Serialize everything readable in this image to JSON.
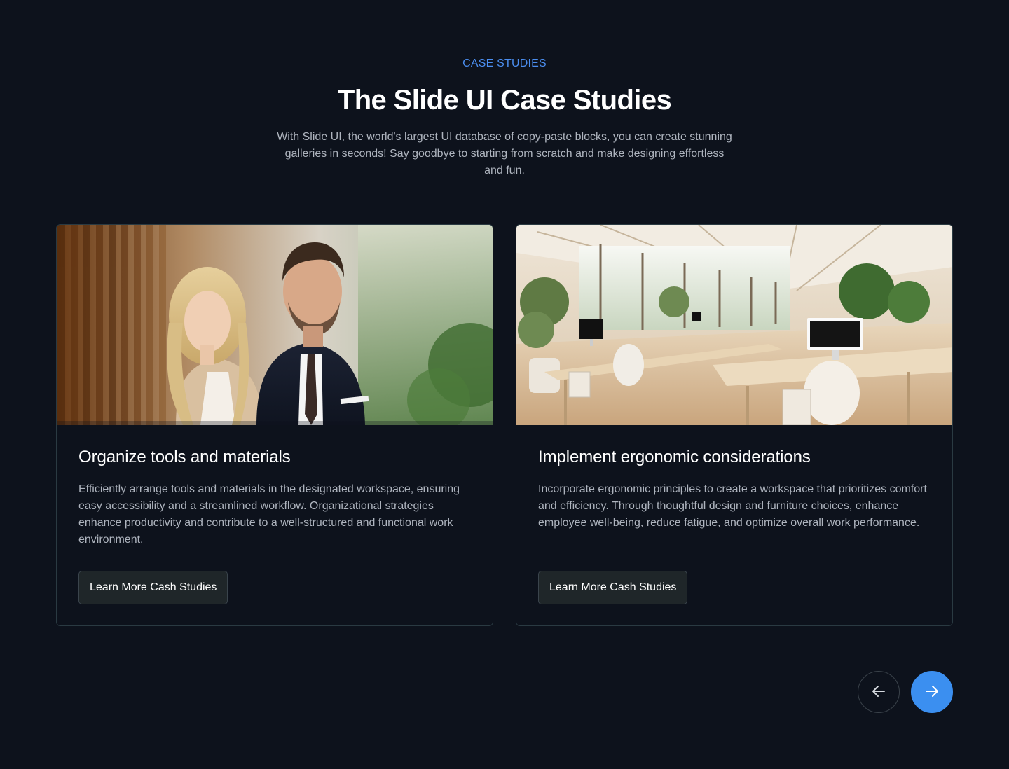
{
  "header": {
    "eyebrow": "CASE STUDIES",
    "title": "The Slide UI Case Studies",
    "subtitle": "With Slide UI, the world's largest UI database of copy-paste blocks, you can create stunning galleries in seconds! Say goodbye to starting from scratch and make designing effortless and fun."
  },
  "cards": [
    {
      "title": "Organize tools and materials",
      "text": "Efficiently arrange tools and materials in the designated workspace, ensuring easy accessibility and a streamlined workflow. Organizational strategies enhance productivity and contribute to a well-structured and functional work environment.",
      "button_label": "Learn More Cash Studies"
    },
    {
      "title": "Implement ergonomic considerations",
      "text": "Incorporate ergonomic principles to create a workspace that prioritizes comfort and efficiency. Through thoughtful design and furniture choices, enhance employee well-being, reduce fatigue, and optimize overall work performance.",
      "button_label": "Learn More Cash Studies"
    }
  ],
  "nav": {
    "prev_icon": "arrow-left-icon",
    "next_icon": "arrow-right-icon"
  },
  "colors": {
    "background": "#0d121c",
    "accent": "#3b8ff0",
    "eyebrow": "#4b8ef0",
    "muted_text": "#aeb4be",
    "card_border": "#2a3a42"
  }
}
